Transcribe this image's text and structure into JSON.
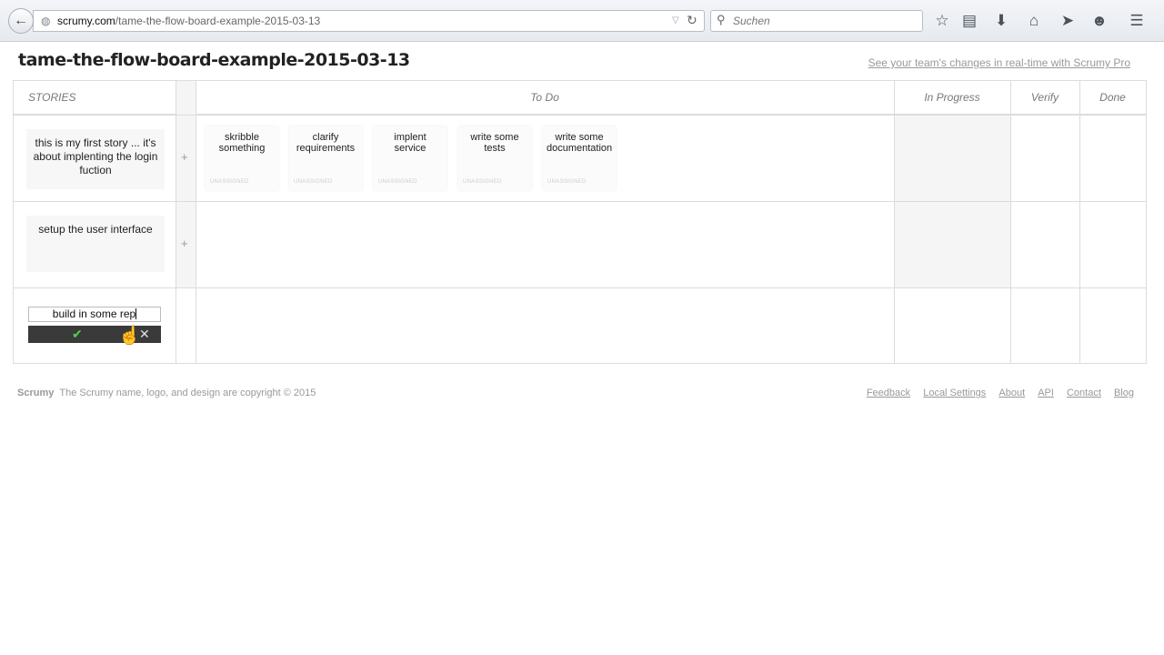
{
  "browser": {
    "url_domain": "scrumy.com",
    "url_path": "/tame-the-flow-board-example-2015-03-13",
    "search_placeholder": "Suchen",
    "icons": [
      "back-arrow-icon",
      "globe-icon",
      "dropdown-icon",
      "reload-icon",
      "search-icon",
      "star-icon",
      "reading-list-icon",
      "download-icon",
      "home-icon",
      "send-icon",
      "chat-icon",
      "menu-icon"
    ]
  },
  "page": {
    "title": "tame-the-flow-board-example-2015-03-13",
    "promo_link": "See your team's changes in real-time with Scrumy Pro"
  },
  "board": {
    "columns": [
      "STORIES",
      "To Do",
      "In Progress",
      "Verify",
      "Done"
    ],
    "stories": [
      {
        "text": "this is my first story ... it's about implenting the login fuction",
        "tasks": [
          {
            "text": "skribble something",
            "assignee": "UNASSIGNED"
          },
          {
            "text": "clarify requirements",
            "assignee": "UNASSIGNED"
          },
          {
            "text": "implent service",
            "assignee": "UNASSIGNED"
          },
          {
            "text": "write some tests",
            "assignee": "UNASSIGNED"
          },
          {
            "text": "write some documentation",
            "assignee": "UNASSIGNED"
          }
        ]
      },
      {
        "text": "setup the user interface",
        "tasks": []
      }
    ],
    "add_task_symbol": "+",
    "new_story_value": "build in some rep"
  },
  "footer": {
    "brand": "Scrumy",
    "copyright": "The Scrumy name, logo, and design are copyright © 2015",
    "links": [
      "Feedback",
      "Local Settings",
      "About",
      "API",
      "Contact",
      "Blog"
    ]
  },
  "colors": {
    "accent_confirm": "#4cd24c",
    "edit_bar": "#3a3a3a",
    "grid": "#dcdcdc"
  }
}
